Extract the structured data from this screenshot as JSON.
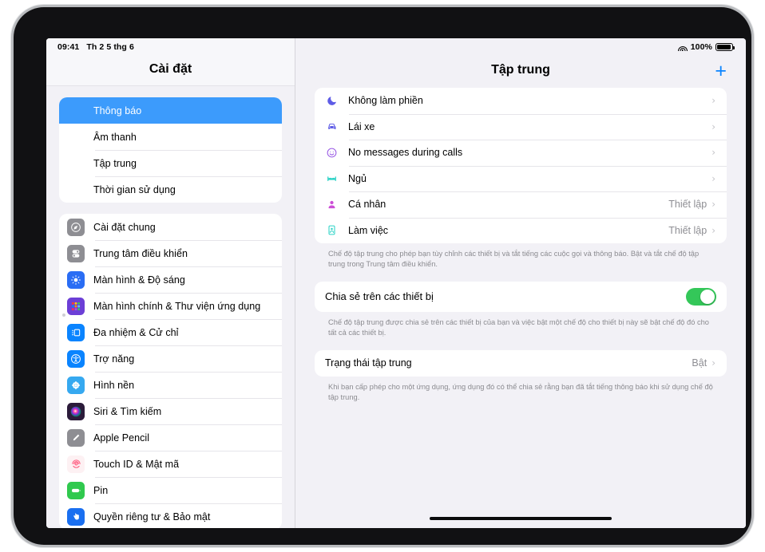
{
  "status_bar": {
    "time": "09:41",
    "date": "Th 2 5 thg 6",
    "wifi_icon": "wifi-icon",
    "battery_percent": "100%",
    "battery_icon": "battery-full-icon"
  },
  "sidebar": {
    "title": "Cài đặt",
    "groups": [
      {
        "items": [
          {
            "label": "Thông báo",
            "icon": "notifications-bell-icon",
            "icon_bg": "#ff3b30",
            "selected": false
          },
          {
            "label": "Âm thanh",
            "icon": "sounds-speaker-icon",
            "icon_bg": "#f6315a",
            "selected": false
          },
          {
            "label": "Tập trung",
            "icon": "focus-moon-icon",
            "icon_bg": "#5e5ce6",
            "selected": true
          },
          {
            "label": "Thời gian sử dụng",
            "icon": "screen-time-hourglass-icon",
            "icon_bg": "#5e5ce6",
            "selected": false
          }
        ]
      },
      {
        "items": [
          {
            "label": "Cài đặt chung",
            "icon": "general-gear-icon",
            "icon_bg": "#8e8e93",
            "selected": false
          },
          {
            "label": "Trung tâm điều khiển",
            "icon": "control-center-icon",
            "icon_bg": "#8e8e93",
            "selected": false
          },
          {
            "label": "Màn hình & Độ sáng",
            "icon": "display-brightness-icon",
            "icon_bg": "#2a6df4",
            "selected": false
          },
          {
            "label": "Màn hình chính & Thư viện ứng dụng",
            "icon": "home-screen-grid-icon",
            "icon_bg": "#6c3fd6",
            "selected": false
          },
          {
            "label": "Đa nhiệm & Cử chỉ",
            "icon": "multitasking-icon",
            "icon_bg": "#0a84ff",
            "selected": false
          },
          {
            "label": "Trợ năng",
            "icon": "accessibility-icon",
            "icon_bg": "#0a84ff",
            "selected": false
          },
          {
            "label": "Hình nền",
            "icon": "wallpaper-flower-icon",
            "icon_bg": "#36a9f0",
            "selected": false
          },
          {
            "label": "Siri & Tìm kiếm",
            "icon": "siri-orb-icon",
            "icon_bg": "#2b1b3a",
            "selected": false
          },
          {
            "label": "Apple Pencil",
            "icon": "apple-pencil-icon",
            "icon_bg": "#8e8e93",
            "selected": false
          },
          {
            "label": "Touch ID & Mật mã",
            "icon": "touch-id-fingerprint-icon",
            "icon_bg": "#fdf1f3",
            "selected": false
          },
          {
            "label": "Pin",
            "icon": "battery-icon",
            "icon_bg": "#30c94e",
            "selected": false
          },
          {
            "label": "Quyền riêng tư & Bảo mật",
            "icon": "privacy-hand-icon",
            "icon_bg": "#1a6ff0",
            "selected": false
          }
        ]
      }
    ]
  },
  "detail": {
    "title": "Tập trung",
    "add_button_label": "+",
    "focus_modes": [
      {
        "label": "Không làm phiền",
        "icon": "moon-icon",
        "icon_color": "#5e5ce6",
        "value": "",
        "chevron": "›"
      },
      {
        "label": "Lái xe",
        "icon": "car-icon",
        "icon_color": "#5e5ce6",
        "value": "",
        "chevron": "›"
      },
      {
        "label": "No messages during calls",
        "icon": "smiley-icon",
        "icon_color": "#9b5de5",
        "value": "",
        "chevron": "›"
      },
      {
        "label": "Ngủ",
        "icon": "bed-icon",
        "icon_color": "#2ed3c6",
        "value": "",
        "chevron": "›"
      },
      {
        "label": "Cá nhân",
        "icon": "person-icon",
        "icon_color": "#c councils",
        "value": "Thiết lập",
        "chevron": "›"
      },
      {
        "label": "Làm việc",
        "icon": "id-card-icon",
        "icon_color": "#2ed3c6",
        "value": "Thiết lập",
        "chevron": "›"
      }
    ],
    "focus_footnote": "Chế độ tập trung cho phép bạn tùy chỉnh các thiết bị và tắt tiếng các cuộc gọi và thông báo. Bật và tắt chế độ tập trung trong Trung tâm điều khiển.",
    "share_row": {
      "label": "Chia sẻ trên các thiết bị",
      "toggle_on": true,
      "toggle_color": "#34c759"
    },
    "share_footnote": "Chế độ tập trung được chia sẻ trên các thiết bị của bạn và việc bật một chế độ cho thiết bị này sẽ bật chế độ đó cho tất cả các thiết bị.",
    "status_row": {
      "label": "Trạng thái tập trung",
      "value": "Bật",
      "chevron": "›"
    },
    "status_footnote": "Khi bạn cấp phép cho một ứng dụng, ứng dụng đó có thể chia sẻ rằng bạn đã tắt tiếng thông báo khi sử dụng chế độ tập trung."
  }
}
